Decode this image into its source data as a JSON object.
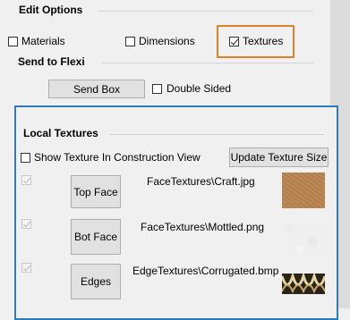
{
  "edit_options": {
    "title": "Edit Options",
    "materials_label": "Materials",
    "materials_checked": false,
    "dimensions_label": "Dimensions",
    "dimensions_checked": false,
    "textures_label": "Textures",
    "textures_checked": true,
    "highlight_color": "#d9822b"
  },
  "send_to_flexi": {
    "title": "Send to Flexi",
    "send_box_label": "Send Box",
    "double_sided_label": "Double Sided",
    "double_sided_checked": false
  },
  "local_textures": {
    "title": "Local Textures",
    "show_texture_label": "Show Texture In Construction View",
    "show_texture_checked": false,
    "update_button_label": "Update Texture Size",
    "frame_color": "#2f7ab8",
    "rows": [
      {
        "button_label": "Top Face",
        "path": "FaceTextures\\Craft.jpg",
        "checked": true,
        "swatch": "craft-texture"
      },
      {
        "button_label": "Bot Face",
        "path": "FaceTextures\\Mottled.png",
        "checked": true,
        "swatch": "mottled-texture"
      },
      {
        "button_label": "Edges",
        "path": "EdgeTextures\\Corrugated.bmp",
        "checked": true,
        "swatch": "corrugated-texture"
      }
    ]
  }
}
